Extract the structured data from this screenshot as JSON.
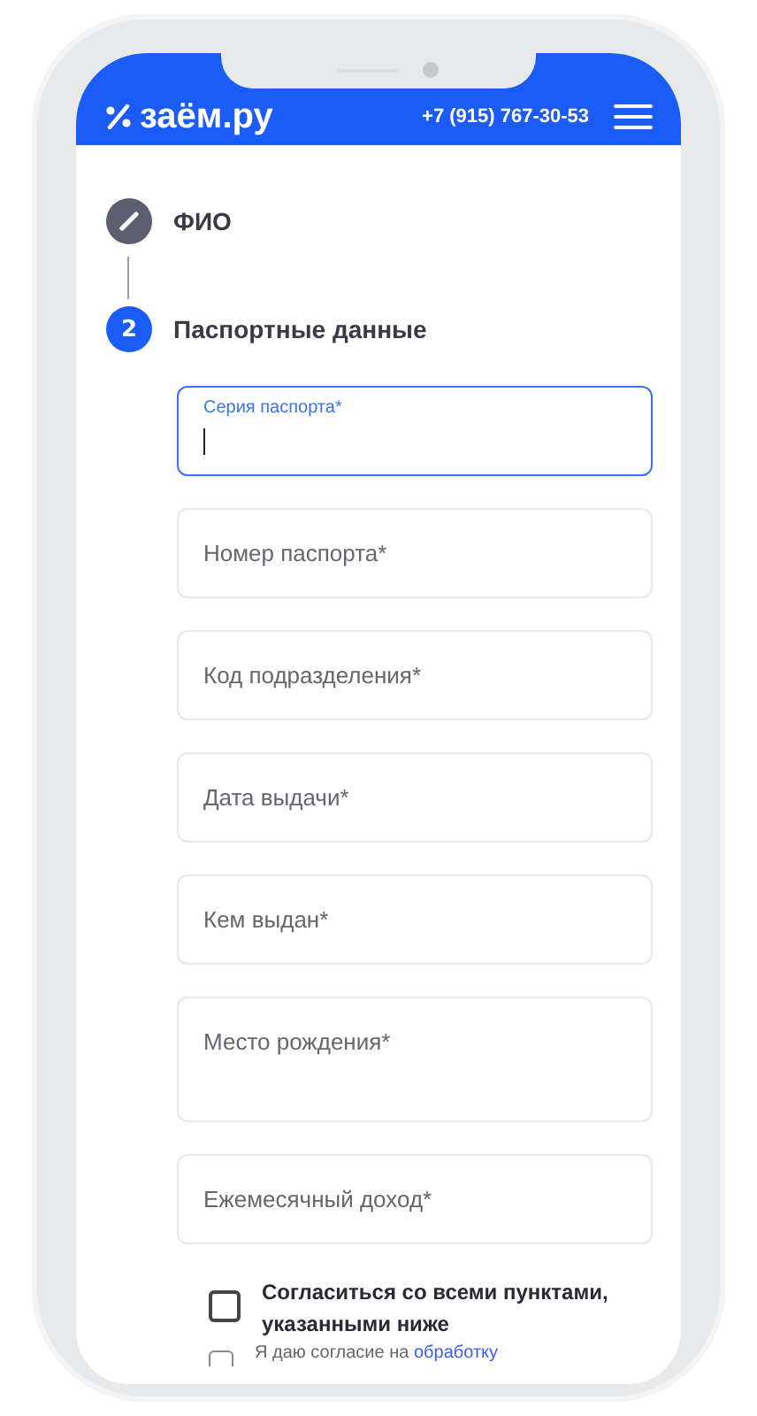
{
  "header": {
    "logo": "заём.ру",
    "phone": "+7 (915) 767-30-53"
  },
  "steps": [
    {
      "kind": "done",
      "label": "ФИО"
    },
    {
      "kind": "current",
      "number": "2",
      "label": "Паспортные данные"
    }
  ],
  "fields": [
    {
      "kind": "single",
      "label": "Серия паспорта*",
      "focused": true
    },
    {
      "kind": "single",
      "label": "Номер паспорта*",
      "focused": false
    },
    {
      "kind": "single",
      "label": "Код подразделения*",
      "focused": false
    },
    {
      "kind": "single",
      "label": "Дата выдачи*",
      "focused": false
    },
    {
      "kind": "single",
      "label": "Кем выдан*",
      "focused": false
    },
    {
      "kind": "multiline",
      "label": "Место рождения*",
      "focused": false
    },
    {
      "kind": "single",
      "label": "Ежемесячный доход*",
      "focused": false
    }
  ],
  "consent_all": {
    "text": "Согласиться со всеми пунктами, указанными ниже",
    "checked": false
  },
  "consent_processing": {
    "text": "Я даю согласие на",
    "link": "обработку",
    "checked": false
  }
}
